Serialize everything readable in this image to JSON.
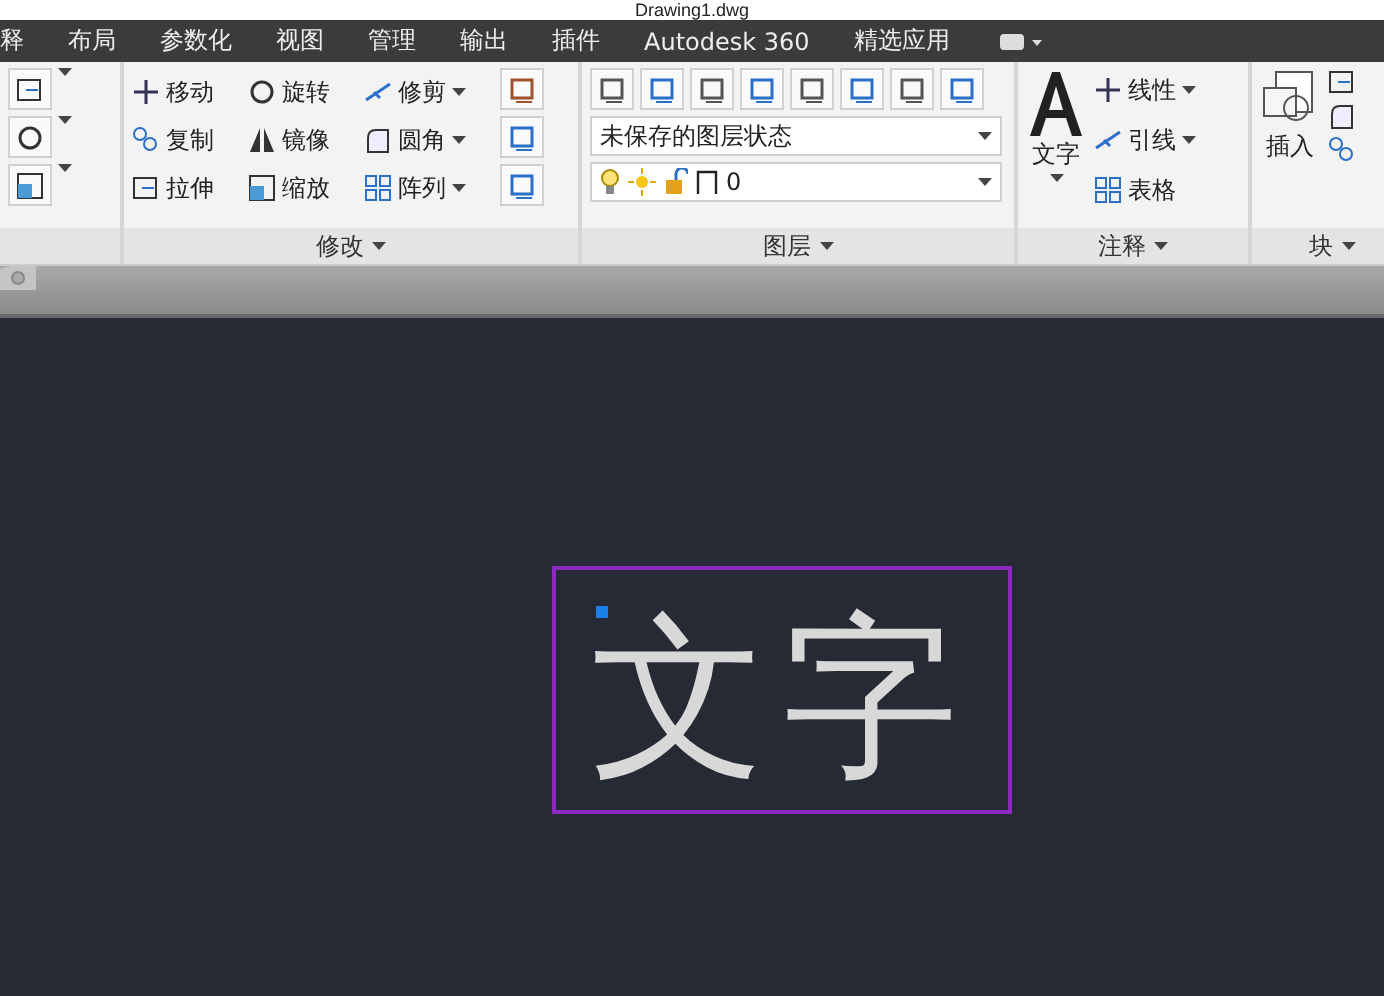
{
  "window": {
    "title": "Drawing1.dwg"
  },
  "menu_tabs": [
    {
      "label": "释"
    },
    {
      "label": "布局"
    },
    {
      "label": "参数化"
    },
    {
      "label": "视图"
    },
    {
      "label": "管理"
    },
    {
      "label": "输出"
    },
    {
      "label": "插件"
    },
    {
      "label": "Autodesk 360"
    },
    {
      "label": "精选应用"
    }
  ],
  "modify_panel": {
    "title": "修改",
    "tools": [
      {
        "label": "移动",
        "dropdown": false
      },
      {
        "label": "旋转",
        "dropdown": false
      },
      {
        "label": "修剪",
        "dropdown": true
      },
      {
        "label": "复制",
        "dropdown": false
      },
      {
        "label": "镜像",
        "dropdown": false
      },
      {
        "label": "圆角",
        "dropdown": true
      },
      {
        "label": "拉伸",
        "dropdown": false
      },
      {
        "label": "缩放",
        "dropdown": false
      },
      {
        "label": "阵列",
        "dropdown": true
      }
    ]
  },
  "layers_panel": {
    "title": "图层",
    "state_dropdown": "未保存的图层状态",
    "layer_dropdown": "0"
  },
  "annotation_panel": {
    "title": "注释",
    "big_tool": "文字",
    "tools": [
      {
        "label": "线性",
        "dropdown": true
      },
      {
        "label": "引线",
        "dropdown": true
      },
      {
        "label": "表格",
        "dropdown": false
      }
    ]
  },
  "block_panel": {
    "title": "块",
    "big_tool": "插入"
  },
  "canvas": {
    "text": "文字"
  }
}
